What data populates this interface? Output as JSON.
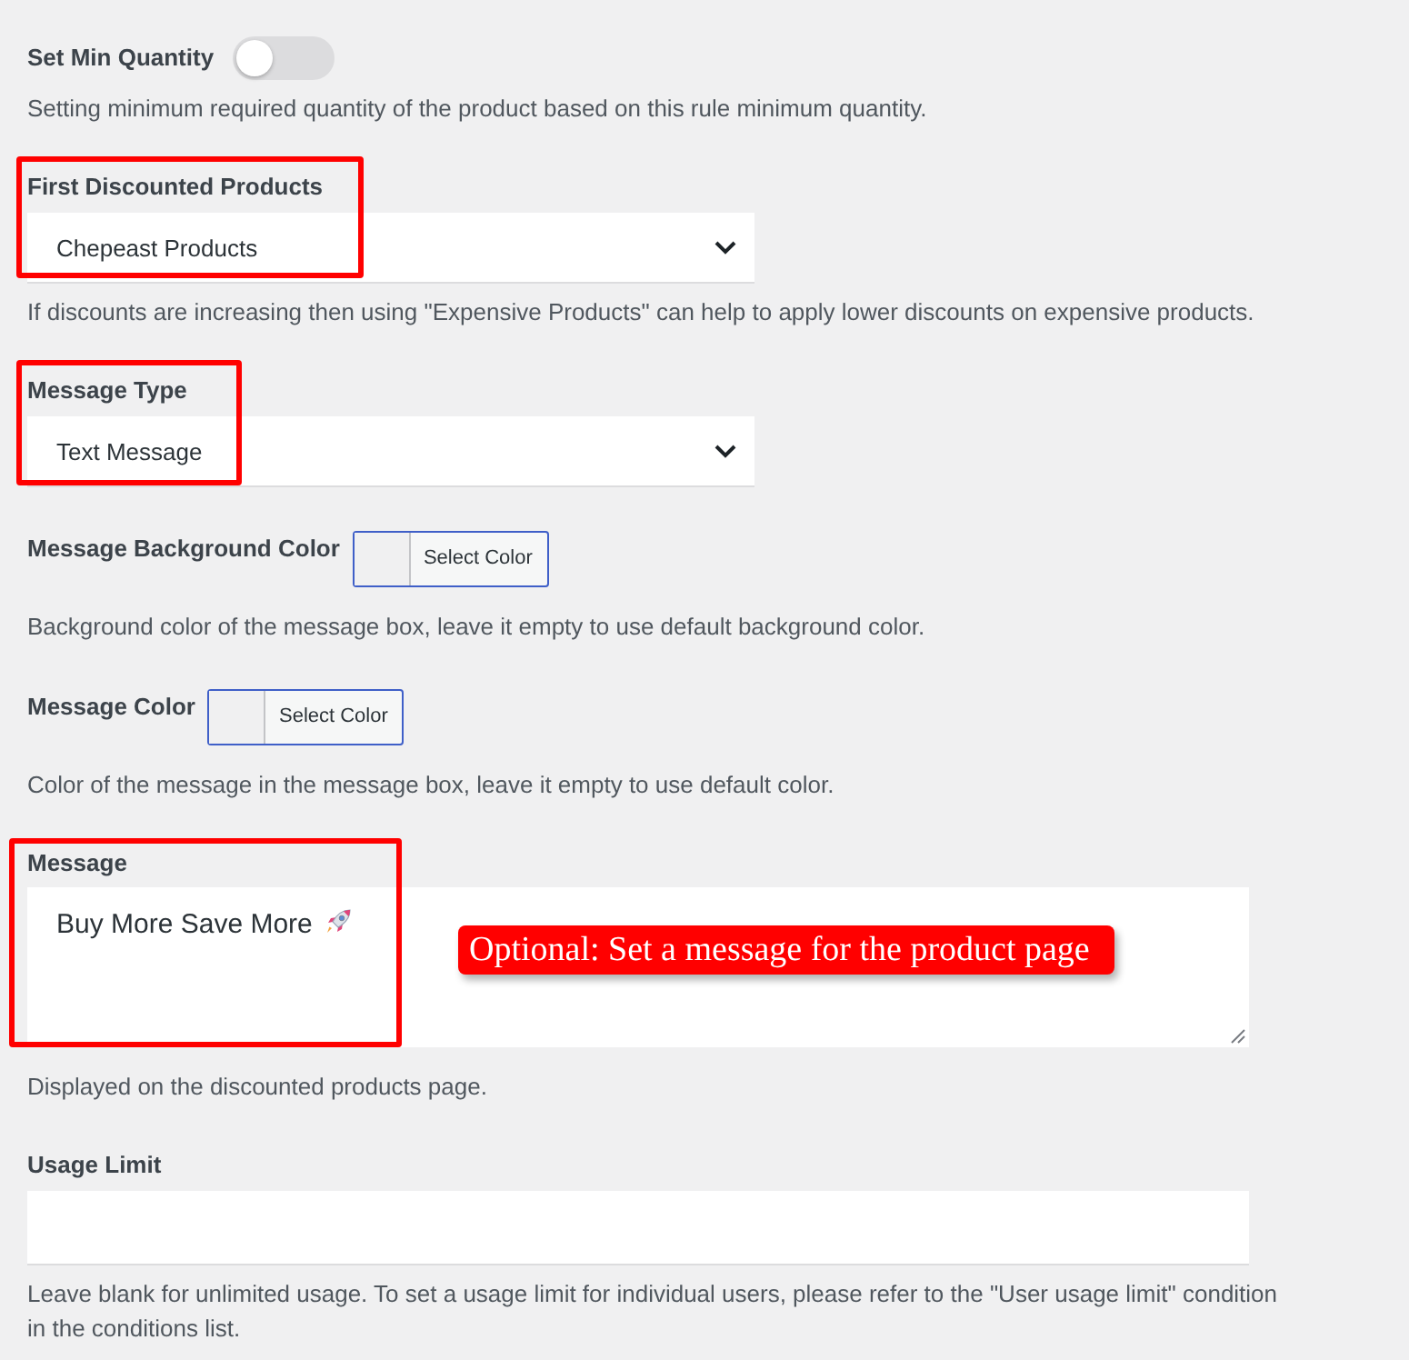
{
  "settings": [
    {
      "kind": "toggle",
      "label": "Set Min Quantity",
      "on": false,
      "description": "Setting minimum required quantity of the product based on this rule minimum quantity."
    },
    {
      "kind": "select",
      "label": "First Discounted Products",
      "value": "Chepeast Products",
      "highlighted": true,
      "description": "If discounts are increasing then using \"Expensive Products\" can help to apply lower discounts on expensive products."
    },
    {
      "kind": "select",
      "label": "Message Type",
      "value": "Text Message",
      "highlighted": true
    },
    {
      "kind": "color",
      "label": "Message Background Color",
      "button": "Select Color",
      "description": "Background color of the message box, leave it empty to use default background color."
    },
    {
      "kind": "color",
      "label": "Message Color",
      "button": "Select Color",
      "description": "Color of the message in the message box, leave it empty to use default color."
    },
    {
      "kind": "textarea",
      "label": "Message",
      "value": "Buy More Save More",
      "highlighted": true,
      "callout": "Optional: Set a message for the product page",
      "description": "Displayed on the discounted products page."
    },
    {
      "kind": "text",
      "label": "Usage Limit",
      "description": "Leave blank for unlimited usage. To set a usage limit for individual users, please refer to the \"User usage limit\" condition in the conditions list."
    }
  ]
}
